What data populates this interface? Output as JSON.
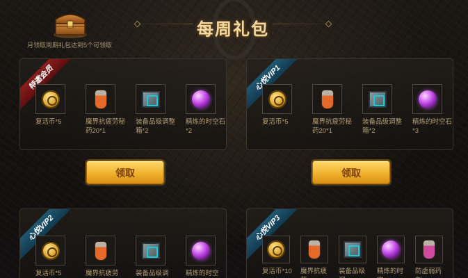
{
  "header": {
    "title": "每周礼包",
    "note": "月领取周期礼包达到5个可领取",
    "chest_icon": "treasure-chest-icon"
  },
  "panels": [
    {
      "badge": "特邀会员",
      "badge_color": "#8d1d1d",
      "items": [
        {
          "name": "复活币*5",
          "icon": "coin-icon"
        },
        {
          "name": "魔界抗疲劳秘药20*1",
          "icon": "potion-icon"
        },
        {
          "name": "装备品级调整箱*2",
          "icon": "crate-icon"
        },
        {
          "name": "精炼的时空石*2",
          "icon": "orb-icon"
        }
      ],
      "claim_label": "领取"
    },
    {
      "badge": "心悦VIP1",
      "badge_color": "#1f5873",
      "items": [
        {
          "name": "复活币*5",
          "icon": "coin-icon"
        },
        {
          "name": "魔界抗疲劳秘药20*1",
          "icon": "potion-icon"
        },
        {
          "name": "装备品级调整箱*2",
          "icon": "crate-icon"
        },
        {
          "name": "精炼的时空石*3",
          "icon": "orb-icon"
        }
      ],
      "claim_label": "领取"
    },
    {
      "badge": "心悦VIP2",
      "badge_color": "#1f5873",
      "items": [
        {
          "name": "复活币*5",
          "icon": "coin-icon"
        },
        {
          "name": "魔界抗疲劳",
          "icon": "potion-icon"
        },
        {
          "name": "装备品级调",
          "icon": "crate-icon"
        },
        {
          "name": "精炼的时空",
          "icon": "orb-icon"
        }
      ]
    },
    {
      "badge": "心悦VIP3",
      "badge_color": "#1f5873",
      "items": [
        {
          "name": "复活币*10",
          "icon": "coin-icon"
        },
        {
          "name": "魔界抗疲劳",
          "icon": "potion-icon"
        },
        {
          "name": "装备品级调",
          "icon": "crate-icon"
        },
        {
          "name": "精炼的时空",
          "icon": "orb-icon"
        },
        {
          "name": "防虚弱药剂",
          "icon": "pink-potion-icon"
        }
      ]
    }
  ]
}
